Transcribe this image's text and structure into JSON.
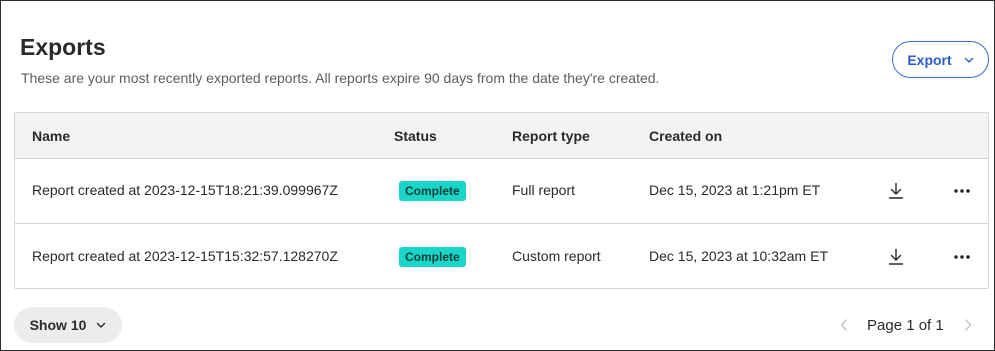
{
  "header": {
    "title": "Exports",
    "subtitle": "These are your most recently exported reports. All reports expire 90 days from the date they're created.",
    "export_label": "Export"
  },
  "table": {
    "columns": [
      "Name",
      "Status",
      "Report type",
      "Created on"
    ],
    "rows": [
      {
        "name": "Report created at 2023-12-15T18:21:39.099967Z",
        "status": "Complete",
        "report_type": "Full report",
        "created_on": "Dec 15, 2023 at 1:21pm ET"
      },
      {
        "name": "Report created at 2023-12-15T15:32:57.128270Z",
        "status": "Complete",
        "report_type": "Custom report",
        "created_on": "Dec 15, 2023 at 10:32am ET"
      }
    ]
  },
  "footer": {
    "show_label": "Show 10",
    "page_label": "Page 1 of 1"
  },
  "colors": {
    "accent": "#2c5cc5",
    "status_complete": "#19d7c8"
  },
  "icons": [
    "chevron-down-icon",
    "download-icon",
    "more-horizontal-icon",
    "chevron-left-icon",
    "chevron-right-icon"
  ]
}
